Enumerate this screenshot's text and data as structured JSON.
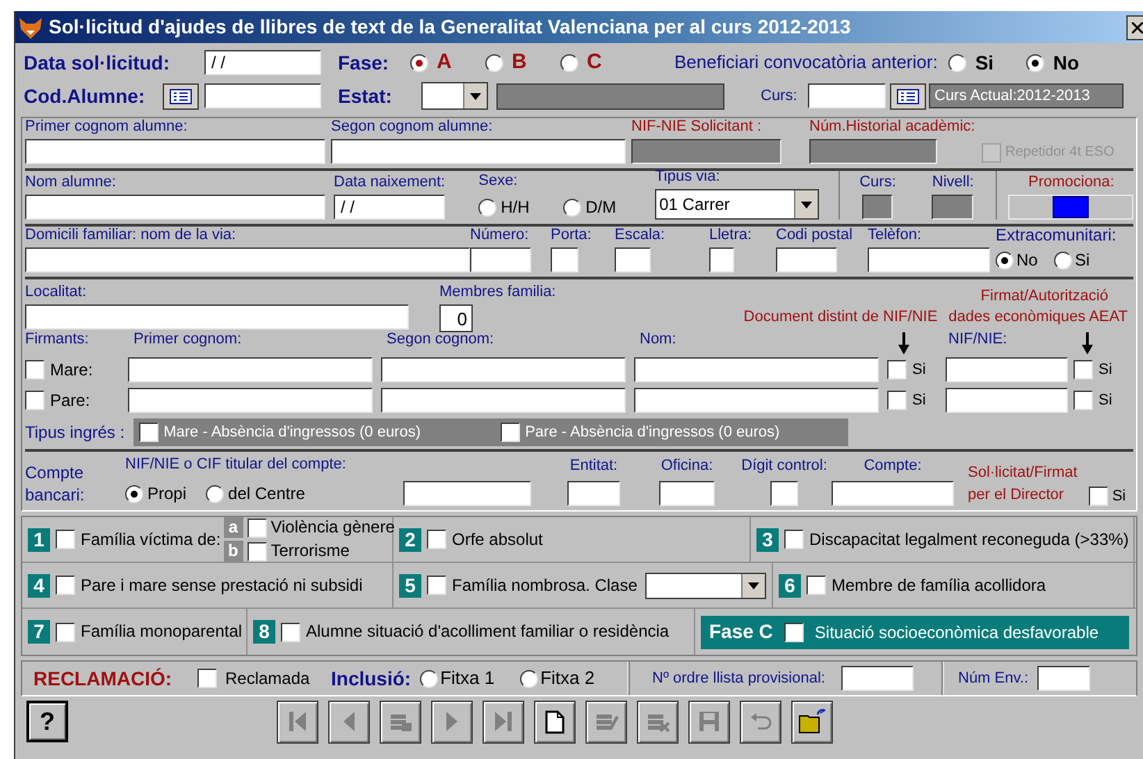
{
  "window": {
    "title": "Sol·licitud d'ajudes de llibres de text de la Generalitat Valenciana per al curs 2012-2013"
  },
  "header": {
    "date_label": "Data sol·licitud:",
    "date_value": "/ /",
    "phase_label": "Fase:",
    "phases": [
      {
        "label": "A",
        "selected": true
      },
      {
        "label": "B",
        "selected": false
      },
      {
        "label": "C",
        "selected": false
      }
    ],
    "previous_label": "Beneficiari convocatòria anterior:",
    "previous_options": [
      {
        "label": "Si",
        "selected": false
      },
      {
        "label": "No",
        "selected": true
      }
    ],
    "code_label": "Cod.Alumne:",
    "status_label": "Estat:",
    "course_label": "Curs:",
    "current_course": "Curs Actual:2012-2013"
  },
  "student": {
    "surname_1_label": "Primer cognom alumne:",
    "surname_2_label": "Segon cognom alumne:",
    "nif_label": "NIF-NIE Solicitant :",
    "record_label": "Núm.Historial acadèmic:",
    "repeater": {
      "label": "Repetidor 4t ESO",
      "checked": false,
      "disabled": true
    },
    "name_label": "Nom alumne:",
    "birth_label": "Data naixement:",
    "birth_value": "/ /",
    "sex_label": "Sexe:",
    "sex_options": [
      {
        "label": "H/H",
        "selected": false
      },
      {
        "label": "D/M",
        "selected": false
      }
    ],
    "street_type_label": "Tipus via:",
    "street_type_value": "01 Carrer",
    "course_label": "Curs:",
    "level_label": "Nivell:",
    "promotes_label": "Promociona:",
    "address_fields": [
      {
        "label": "Domicili familiar: nom de la via:"
      },
      {
        "label": "Número:"
      },
      {
        "label": "Porta:"
      },
      {
        "label": "Escala:"
      },
      {
        "label": "Lletra:"
      },
      {
        "label": "Codi postal"
      },
      {
        "label": "Telèfon:"
      }
    ],
    "non_eu_label": "Extracomunitari:",
    "non_eu_options": [
      {
        "label": "No",
        "selected": true
      },
      {
        "label": "Si",
        "selected": false
      }
    ]
  },
  "family": {
    "town_label": "Localitat:",
    "members_label": "Membres familia:",
    "members_value": "0",
    "aeat_label_lines": [
      "Firmat/Autorització",
      "dades econòmiques AEAT"
    ],
    "document_label": "Document distint de NIF/NIE",
    "signers_label": "Firmants:",
    "columns": [
      "Primer cognom:",
      "Segon cognom:",
      "Nom:",
      "NIF/NIE:"
    ],
    "signers": [
      {
        "label": "Mare:",
        "checked": false,
        "other_document": {
          "label": "Si",
          "checked": false
        },
        "aeat": {
          "label": "Si",
          "checked": false
        }
      },
      {
        "label": "Pare:",
        "checked": false,
        "other_document": {
          "label": "Si",
          "checked": false
        },
        "aeat": {
          "label": "Si",
          "checked": false
        }
      }
    ],
    "income_label": "Tipus ingrés :",
    "income_options": [
      {
        "label": "Mare - Absència d'ingressos (0 euros)",
        "checked": false
      },
      {
        "label": "Pare - Absència d'ingressos (0 euros)",
        "checked": false
      }
    ]
  },
  "bank": {
    "label_lines": [
      "Compte",
      "bancari:"
    ],
    "holder_label": "NIF/NIE o CIF titular del compte:",
    "holder_options": [
      {
        "label": "Propi",
        "selected": true
      },
      {
        "label": "del Centre",
        "selected": false
      }
    ],
    "fields": [
      {
        "label": "Entitat:"
      },
      {
        "label": "Oficina:"
      },
      {
        "label": "Dígit control:"
      },
      {
        "label": "Compte:"
      }
    ],
    "director_lines": [
      "Sol·licitat/Firmat",
      "per el Director"
    ],
    "director_check": {
      "label": "Si",
      "checked": false
    }
  },
  "criteria": [
    [
      {
        "kind": "options",
        "number": "1",
        "label": "Família víctima de:",
        "checked": false,
        "sub_options": [
          {
            "letter": "a",
            "label": "Violència gènere",
            "checked": false
          },
          {
            "letter": "b",
            "label": "Terrorisme",
            "checked": false
          }
        ]
      },
      {
        "kind": "check",
        "number": "2",
        "label": "Orfe absolut",
        "checked": false
      },
      {
        "kind": "check",
        "number": "3",
        "label": "Discapacitat legalment reconeguda (>33%)",
        "checked": false
      }
    ],
    [
      {
        "kind": "check",
        "number": "4",
        "label": "Pare i mare sense prestació ni subsidi",
        "checked": false
      },
      {
        "kind": "select",
        "number": "5",
        "label": "Família nombrosa. Clase",
        "checked": false
      },
      {
        "kind": "check",
        "number": "6",
        "label": "Membre de família acollidora",
        "checked": false
      }
    ],
    [
      {
        "kind": "check",
        "number": "7",
        "label": "Família monoparental",
        "checked": false
      },
      {
        "kind": "check",
        "number": "8",
        "label": "Alumne situació d'acolliment familiar o residència",
        "checked": false
      },
      {
        "kind": "highlight",
        "tag": "Fase C",
        "label": "Situació socioeconòmica desfavorable",
        "checked": false
      }
    ]
  ],
  "claim": {
    "label": "RECLAMACIÓ:",
    "check": {
      "label": "Reclamada",
      "checked": false
    },
    "inclusion_label": "Inclusió:",
    "inclusion_options": [
      {
        "label": "Fitxa 1",
        "selected": false
      },
      {
        "label": "Fitxa 2",
        "selected": false
      }
    ],
    "order_label": "Nº ordre llista provisional:",
    "env_label": "Núm Env.:"
  },
  "toolbar": {
    "help": "?",
    "buttons": [
      {
        "kind": "first",
        "disabled": true
      },
      {
        "kind": "previous",
        "disabled": true
      },
      {
        "kind": "search",
        "disabled": true
      },
      {
        "kind": "next",
        "disabled": true
      },
      {
        "kind": "last",
        "disabled": true
      },
      {
        "kind": "new",
        "disabled": false
      },
      {
        "kind": "edit",
        "disabled": true
      },
      {
        "kind": "delete",
        "disabled": true
      },
      {
        "kind": "save",
        "disabled": true
      },
      {
        "kind": "undo",
        "disabled": true
      },
      {
        "kind": "open",
        "disabled": false
      }
    ]
  }
}
